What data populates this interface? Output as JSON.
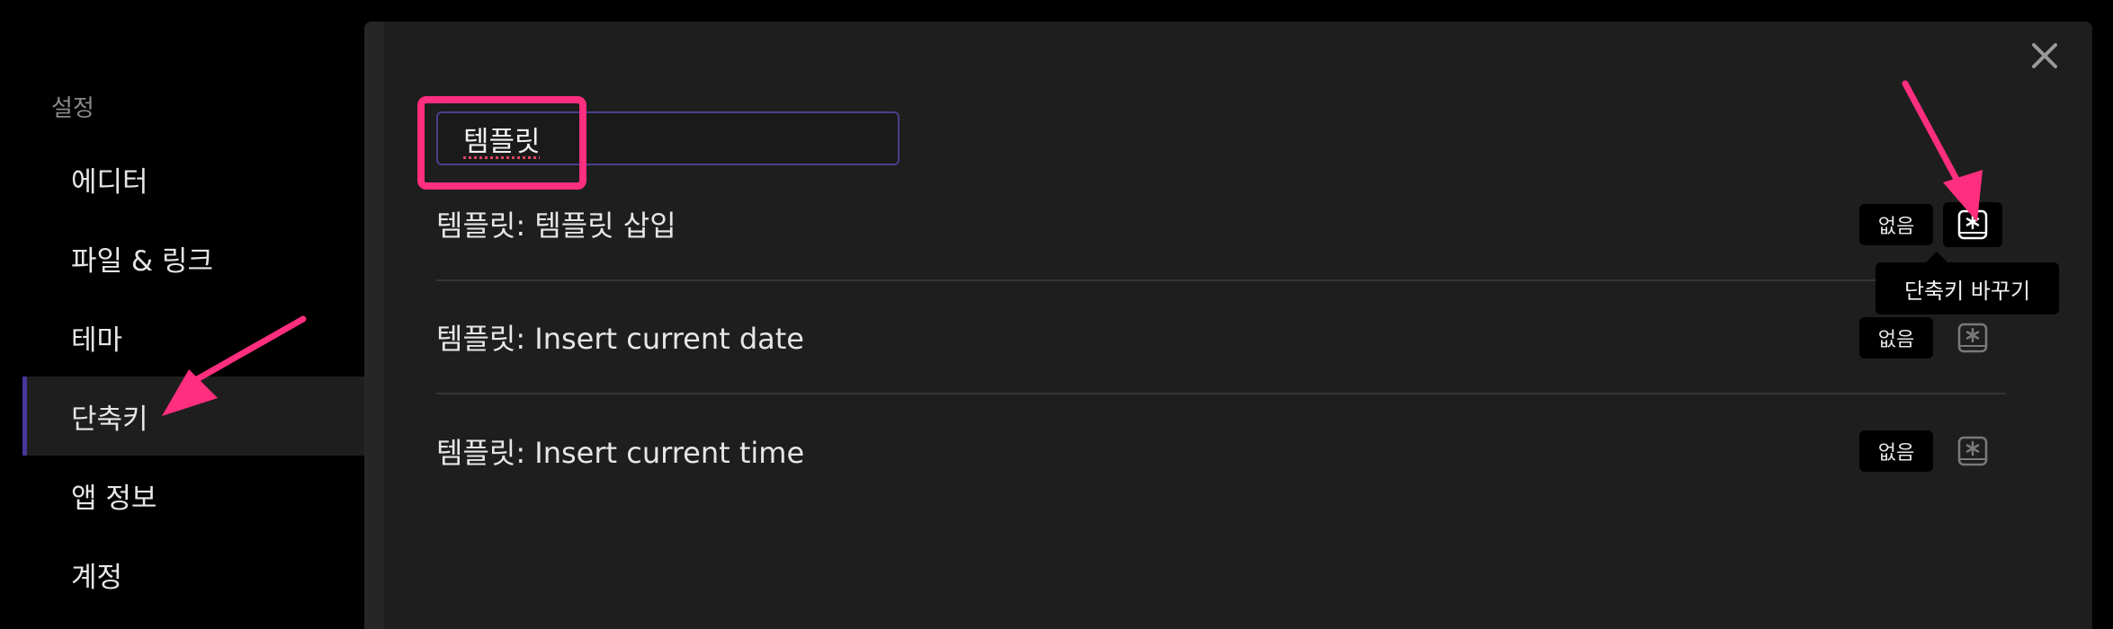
{
  "sidebar": {
    "header": "설정",
    "items": [
      {
        "label": "에디터"
      },
      {
        "label": "파일 & 링크"
      },
      {
        "label": "테마"
      },
      {
        "label": "단축키",
        "active": true
      },
      {
        "label": "앱 정보"
      },
      {
        "label": "계정"
      }
    ]
  },
  "search": {
    "value": "템플릿"
  },
  "hotkeys": [
    {
      "label": "템플릿: 템플릿 삽입",
      "binding": "없음"
    },
    {
      "label": "템플릿: Insert current date",
      "binding": "없음"
    },
    {
      "label": "템플릿: Insert current time",
      "binding": "없음"
    }
  ],
  "tooltip": "단축키 바꾸기",
  "icons": {
    "close": "close-icon",
    "set_hotkey": "asterisk-key-icon"
  },
  "colors": {
    "accent": "#483699",
    "annotation": "#ff2e7e",
    "panel_bg": "#1e1e1e",
    "sidebar_bg": "#000000"
  }
}
